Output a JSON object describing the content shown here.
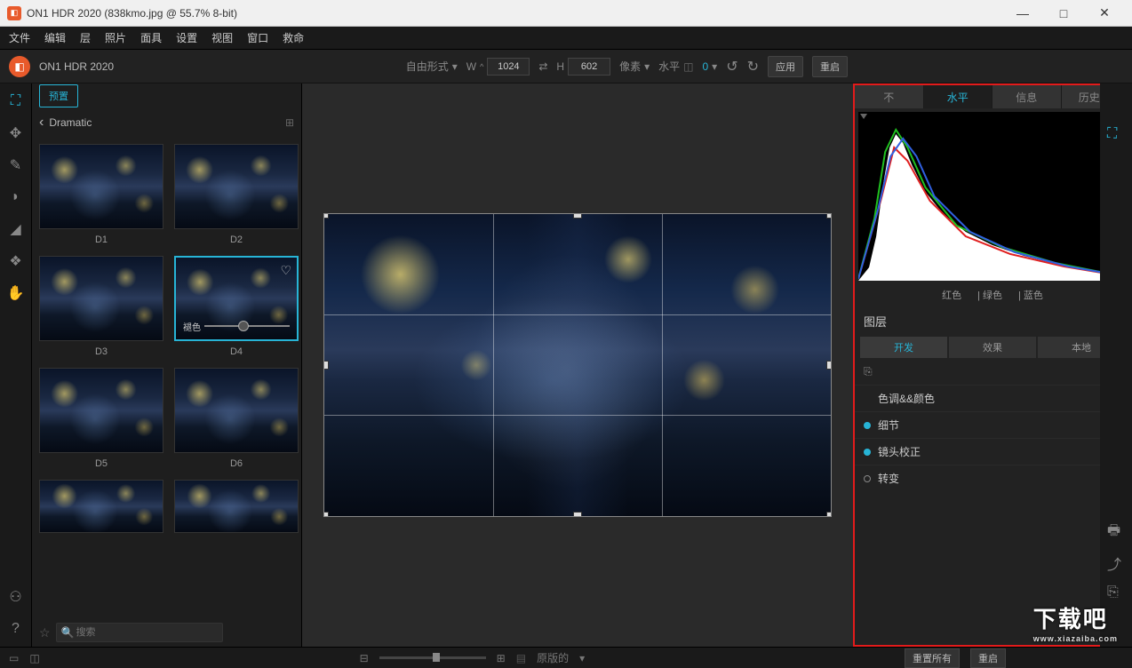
{
  "window": {
    "title": "ON1 HDR 2020 (838kmo.jpg @ 55.7% 8-bit)"
  },
  "menu": [
    "文件",
    "编辑",
    "层",
    "照片",
    "面具",
    "设置",
    "视图",
    "窗口",
    "救命"
  ],
  "toolbar": {
    "appname": "ON1 HDR 2020",
    "mode_label": "自由形式",
    "mode_arrow": "▾",
    "w_label": "W",
    "w_value": "1024",
    "swap": "⇄",
    "h_label": "H",
    "h_value": "602",
    "px_label": "像素",
    "px_arrow": "▾",
    "level_label": "水平",
    "angle_value": "0",
    "angle_arrow": "▾",
    "apply": "应用",
    "reset": "重启"
  },
  "browser": {
    "tab": "预置",
    "back": "‹",
    "crumb": "Dramatic",
    "view_icon": "⊞",
    "thumbs": [
      {
        "label": "D1"
      },
      {
        "label": "D2"
      },
      {
        "label": "D3"
      },
      {
        "label": "D4",
        "selected": true,
        "slider_label": "褪色"
      },
      {
        "label": "D5"
      },
      {
        "label": "D6"
      },
      {
        "label": ""
      },
      {
        "label": ""
      }
    ],
    "search_placeholder": "搜索"
  },
  "right": {
    "tabs": [
      {
        "label": "不"
      },
      {
        "label": "水平",
        "active": true
      },
      {
        "label": "信息"
      },
      {
        "label": "历史",
        "icon": "↺"
      }
    ],
    "histo_labels": [
      "红色",
      "| 绿色",
      "| 蓝色"
    ],
    "layers_title": "图层",
    "subtabs": [
      {
        "label": "开发",
        "active": true
      },
      {
        "label": "效果"
      },
      {
        "label": "本地"
      }
    ],
    "adjustments": [
      {
        "label": "色调&&颜色",
        "dot": "none"
      },
      {
        "label": "细节",
        "dot": "filled"
      },
      {
        "label": "镜头校正",
        "dot": "filled"
      },
      {
        "label": "转变",
        "dot": "hollow"
      }
    ]
  },
  "bottom": {
    "orig_label": "原版的",
    "reset_all": "重置所有",
    "reset": "重启"
  },
  "watermark": {
    "big": "下载吧",
    "small": "www.xiazaiba.com"
  }
}
